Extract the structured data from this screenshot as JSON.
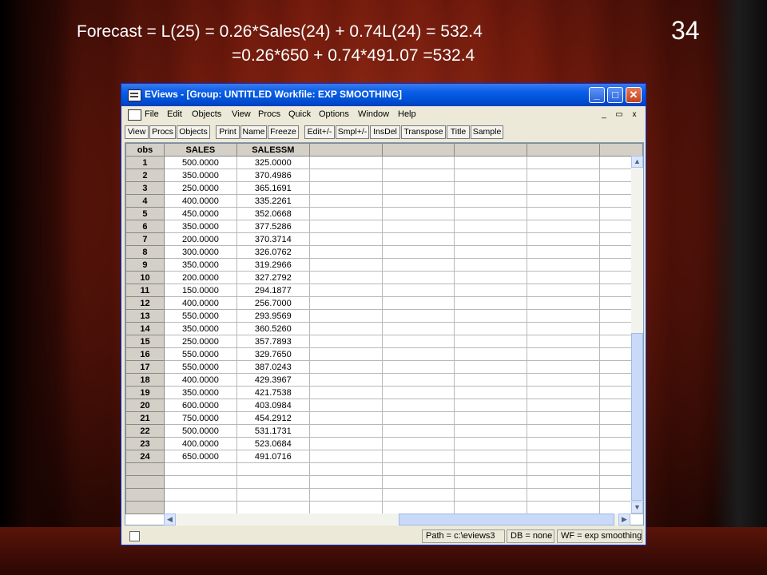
{
  "slide": {
    "line1": "Forecast = L(25) = 0.26*Sales(24) + 0.74L(24) = 532.4",
    "line2": "=0.26*650 + 0.74*491.07 =532.4",
    "number": "34"
  },
  "window": {
    "title": "EViews - [Group: UNTITLED   Workfile: EXP SMOOTHING]",
    "minimize": "_",
    "maximize": "□",
    "close": "✕"
  },
  "menu": {
    "items": [
      "File",
      "Edit",
      "Objects",
      "View",
      "Procs",
      "Quick",
      "Options",
      "Window",
      "Help"
    ],
    "mdi_min": "_",
    "mdi_restore": "▭",
    "mdi_close": "x"
  },
  "toolbar": {
    "buttons": [
      "View",
      "Procs",
      "Objects",
      "Print",
      "Name",
      "Freeze",
      "Edit+/-",
      "Smpl+/-",
      "InsDel",
      "Transpose",
      "Title",
      "Sample"
    ]
  },
  "table": {
    "headers": [
      "obs",
      "SALES",
      "SALESSM"
    ],
    "rows": [
      [
        "1",
        "500.0000",
        "325.0000"
      ],
      [
        "2",
        "350.0000",
        "370.4986"
      ],
      [
        "3",
        "250.0000",
        "365.1691"
      ],
      [
        "4",
        "400.0000",
        "335.2261"
      ],
      [
        "5",
        "450.0000",
        "352.0668"
      ],
      [
        "6",
        "350.0000",
        "377.5286"
      ],
      [
        "7",
        "200.0000",
        "370.3714"
      ],
      [
        "8",
        "300.0000",
        "326.0762"
      ],
      [
        "9",
        "350.0000",
        "319.2966"
      ],
      [
        "10",
        "200.0000",
        "327.2792"
      ],
      [
        "11",
        "150.0000",
        "294.1877"
      ],
      [
        "12",
        "400.0000",
        "256.7000"
      ],
      [
        "13",
        "550.0000",
        "293.9569"
      ],
      [
        "14",
        "350.0000",
        "360.5260"
      ],
      [
        "15",
        "250.0000",
        "357.7893"
      ],
      [
        "16",
        "550.0000",
        "329.7650"
      ],
      [
        "17",
        "550.0000",
        "387.0243"
      ],
      [
        "18",
        "400.0000",
        "429.3967"
      ],
      [
        "19",
        "350.0000",
        "421.7538"
      ],
      [
        "20",
        "600.0000",
        "403.0984"
      ],
      [
        "21",
        "750.0000",
        "454.2912"
      ],
      [
        "22",
        "500.0000",
        "531.1731"
      ],
      [
        "23",
        "400.0000",
        "523.0684"
      ],
      [
        "24",
        "650.0000",
        "491.0716"
      ]
    ]
  },
  "status": {
    "path": "Path = c:\\eviews3",
    "db": "DB = none",
    "wf": "WF = exp smoothing"
  }
}
